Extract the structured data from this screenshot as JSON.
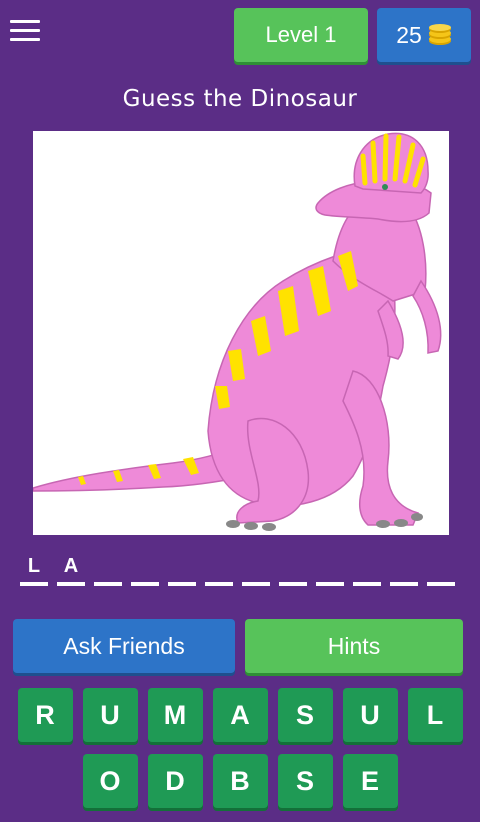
{
  "header": {
    "level_label": "Level 1",
    "coins": "25"
  },
  "title": "Guess the Dinosaur",
  "image": {
    "icon": "dinosaur-picture",
    "colors": {
      "body": "#ee8ad8",
      "stripes": "#ffe200",
      "background": "#ffffff"
    }
  },
  "answer": {
    "slots": [
      "L",
      "A",
      "",
      "",
      "",
      "",
      "",
      "",
      "",
      "",
      "",
      ""
    ]
  },
  "actions": {
    "ask_friends": "Ask Friends",
    "hints": "Hints"
  },
  "letters": {
    "row1": [
      "R",
      "U",
      "M",
      "A",
      "S",
      "U",
      "L"
    ],
    "row2": [
      "O",
      "D",
      "B",
      "S",
      "E"
    ]
  },
  "colors": {
    "background": "#5b2d86",
    "green": "#57c35a",
    "blue": "#2d74c8",
    "key_green": "#1f9a55",
    "coin": "#f5c518"
  }
}
